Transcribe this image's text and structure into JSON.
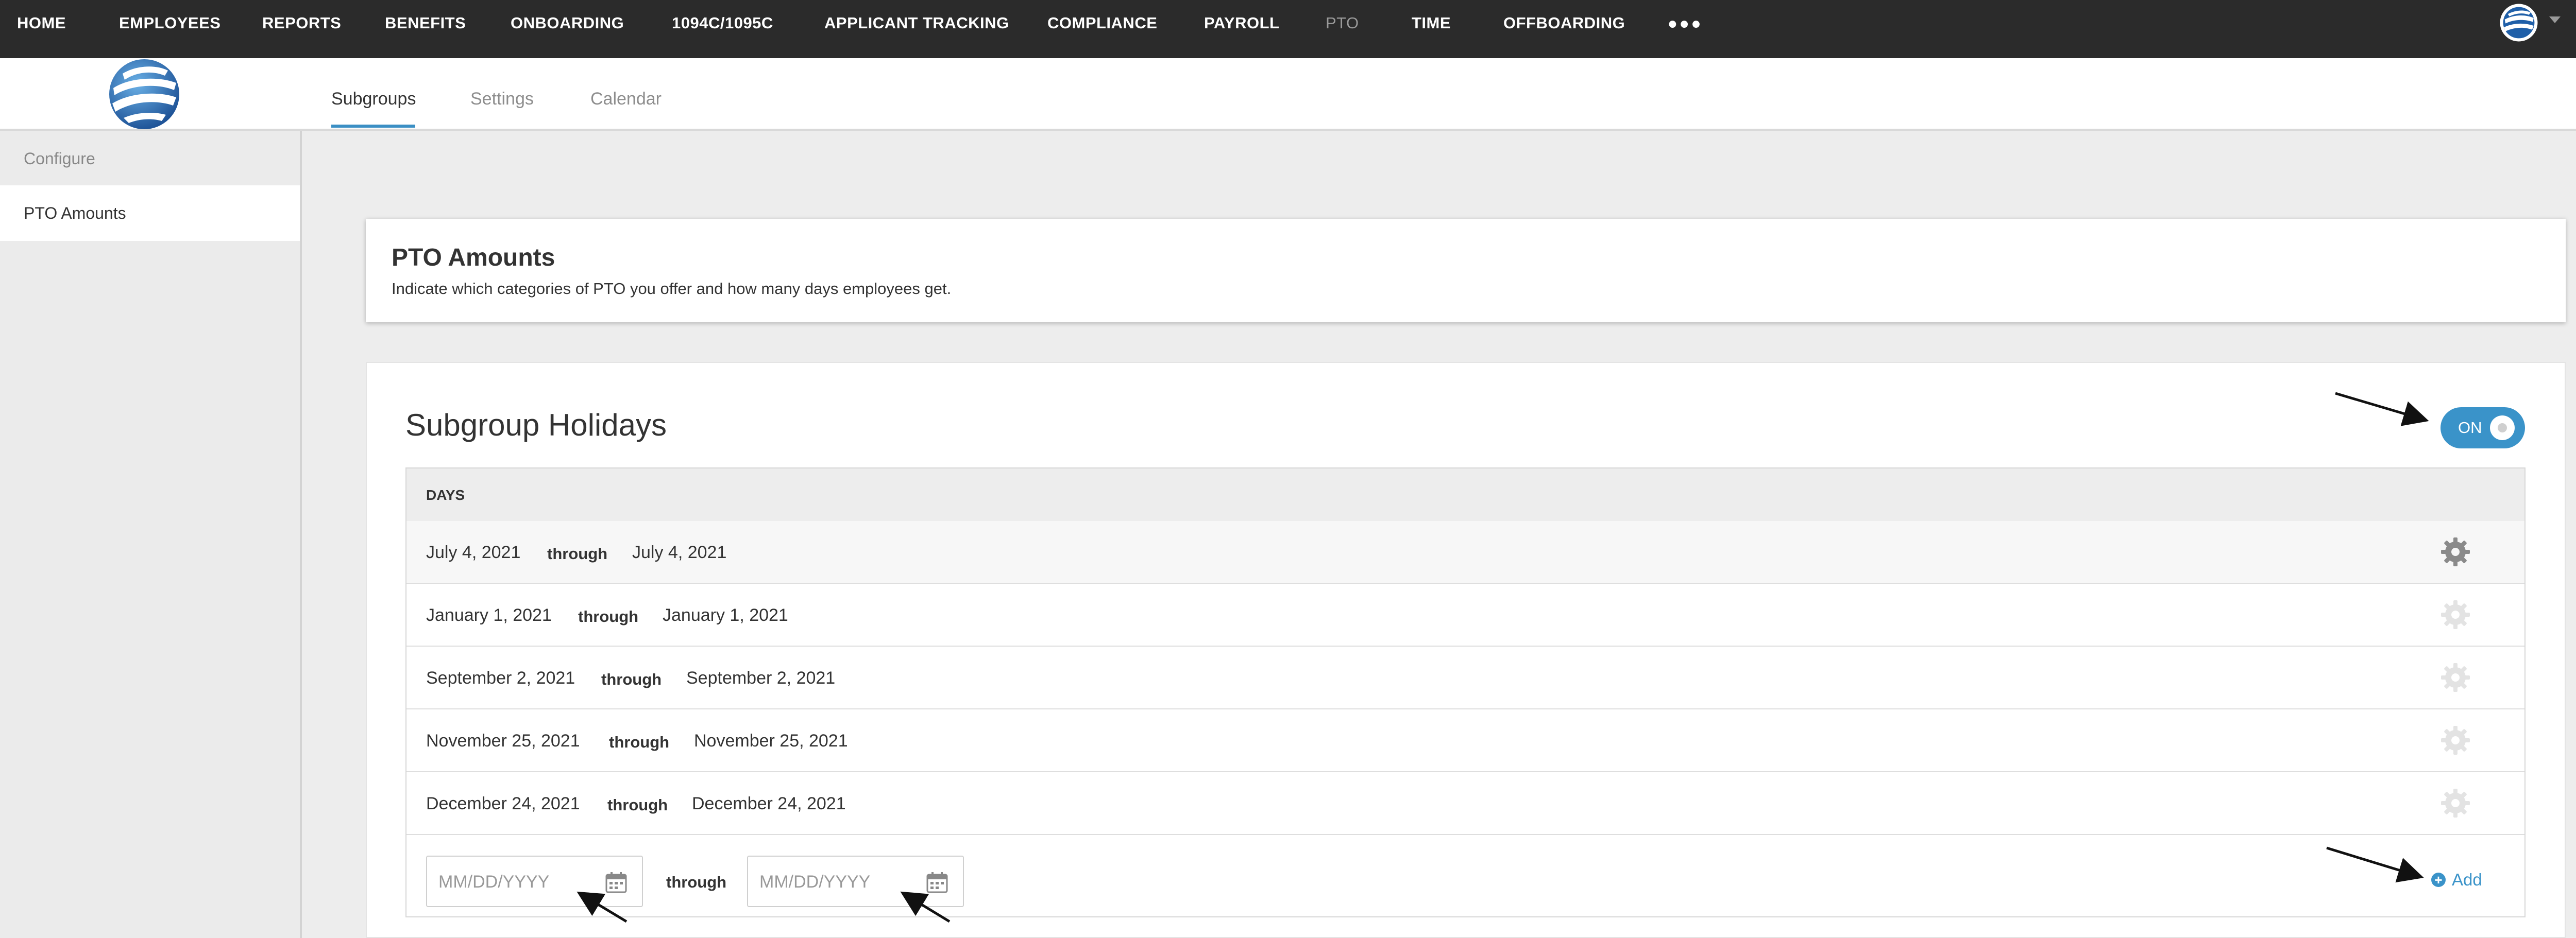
{
  "topnav": {
    "items": [
      {
        "label": "HOME"
      },
      {
        "label": "EMPLOYEES"
      },
      {
        "label": "REPORTS"
      },
      {
        "label": "BENEFITS"
      },
      {
        "label": "ONBOARDING"
      },
      {
        "label": "1094C/1095C"
      },
      {
        "label": "APPLICANT TRACKING"
      },
      {
        "label": "COMPLIANCE"
      },
      {
        "label": "PAYROLL"
      },
      {
        "label": "PTO"
      },
      {
        "label": "TIME"
      },
      {
        "label": "OFFBOARDING"
      }
    ],
    "more_label": "•••",
    "active_item": "PTO"
  },
  "tabs": [
    {
      "label": "Subgroups",
      "active": true
    },
    {
      "label": "Settings",
      "active": false
    },
    {
      "label": "Calendar",
      "active": false
    }
  ],
  "sidebar": {
    "items": [
      {
        "label": "Configure"
      },
      {
        "label": "PTO Amounts",
        "active": true
      }
    ]
  },
  "header_card": {
    "title": "PTO Amounts",
    "description": "Indicate which categories of PTO you offer and how many days employees get."
  },
  "holidays": {
    "title": "Subgroup Holidays",
    "toggle": {
      "label": "ON",
      "state": "on"
    },
    "column_header": "DAYS",
    "through_label": "through",
    "rows": [
      {
        "start": "July 4, 2021",
        "end": "July 4, 2021"
      },
      {
        "start": "January 1, 2021",
        "end": "January 1, 2021"
      },
      {
        "start": "September 2, 2021",
        "end": "September 2, 2021"
      },
      {
        "start": "November 25, 2021",
        "end": "November 25, 2021"
      },
      {
        "start": "December 24, 2021",
        "end": "December 24, 2021"
      }
    ],
    "new_row": {
      "start_placeholder": "MM/DD/YYYY",
      "end_placeholder": "MM/DD/YYYY",
      "through_label": "through",
      "add_label": "Add"
    }
  },
  "colors": {
    "nav_bg": "#2b2b2b",
    "accent": "#3a93c9",
    "page_bg": "#ededed"
  },
  "icons": [
    "logo-globe",
    "avatar",
    "chevron-down-icon",
    "trash-icon",
    "gear-icon",
    "calendar-icon",
    "plus-circle-icon"
  ]
}
